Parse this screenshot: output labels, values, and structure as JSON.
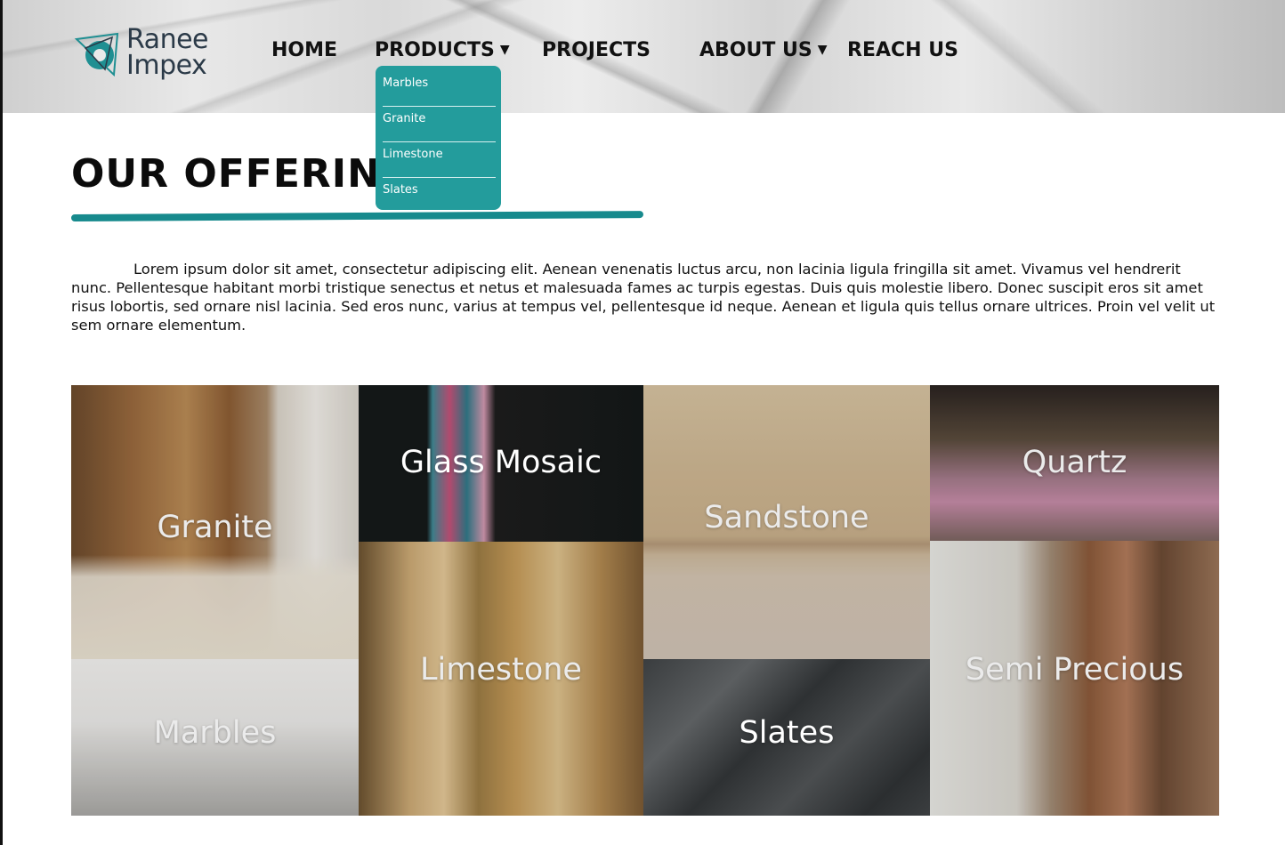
{
  "brand": {
    "line1": "Ranee",
    "line2": "Impex"
  },
  "nav": {
    "home": "HOME",
    "products": "PRODUCTS",
    "projects": "PROJECTS",
    "about": "ABOUT US",
    "reach": "REACH US",
    "caret": "▼"
  },
  "products_menu": [
    "Marbles",
    "Granite",
    "Limestone",
    "Slates"
  ],
  "section": {
    "title": "OUR OFFERINGS",
    "intro": "Lorem ipsum dolor sit amet, consectetur adipiscing elit. Aenean venenatis luctus arcu, non lacinia ligula fringilla sit amet. Vivamus vel hendrerit nunc. Pellentesque habitant morbi tristique senectus et netus et malesuada fames ac turpis egestas. Duis quis molestie libero. Donec suscipit eros sit amet risus lobortis, sed ornare nisl lacinia. Sed eros nunc, varius at tempus vel, pellentesque id neque. Aenean et ligula quis tellus ornare ultrices. Proin vel velit ut sem ornare elementum."
  },
  "offerings": {
    "granite": "Granite",
    "glass_mosaic": "Glass Mosaic",
    "sandstone": "Sandstone",
    "quartz": "Quartz",
    "marbles": "Marbles",
    "limestone": "Limestone",
    "slates": "Slates",
    "semi_precious": "Semi Precious"
  },
  "colors": {
    "accent": "#239c9c",
    "rule": "#178a8d"
  }
}
